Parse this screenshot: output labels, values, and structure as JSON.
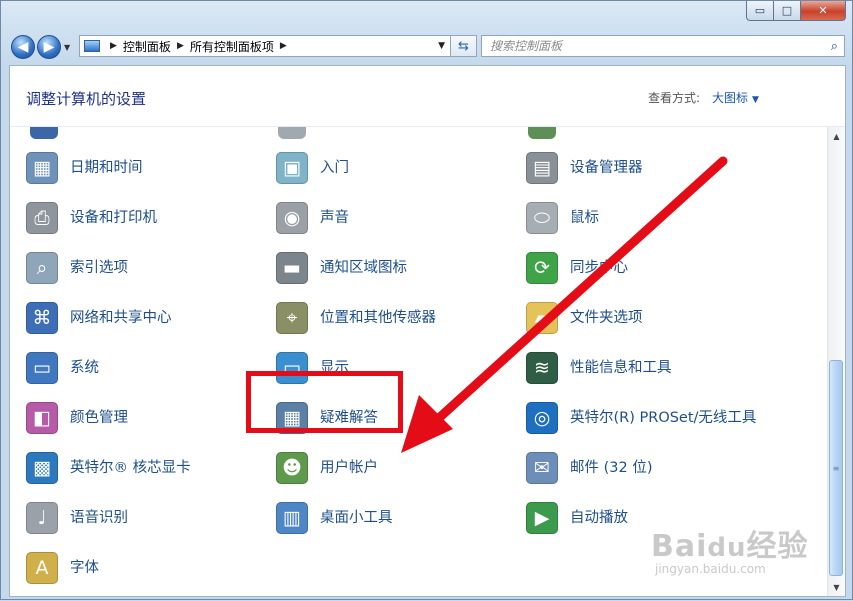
{
  "window": {
    "minimize_glyph": "▭",
    "maximize_glyph": "□",
    "close_glyph": "✕"
  },
  "navigation": {
    "back_glyph": "◀",
    "forward_glyph": "▶",
    "breadcrumb": [
      "控制面板",
      "所有控制面板项"
    ],
    "search_placeholder": "搜索控制面板"
  },
  "header": {
    "title": "调整计算机的设置",
    "view_by_label": "查看方式:",
    "view_by_value": "大图标"
  },
  "items": [
    {
      "label": "日期和时间",
      "icon": "calendar-clock-icon",
      "color": "#6f93b8",
      "glyph": "▦"
    },
    {
      "label": "入门",
      "icon": "getting-started-icon",
      "color": "#7fb3c8",
      "glyph": "▣"
    },
    {
      "label": "设备管理器",
      "icon": "device-manager-icon",
      "color": "#8a9097",
      "glyph": "▤"
    },
    {
      "label": "设备和打印机",
      "icon": "printer-icon",
      "color": "#8e959c",
      "glyph": "⎙"
    },
    {
      "label": "声音",
      "icon": "speaker-icon",
      "color": "#9aa0a6",
      "glyph": "◉"
    },
    {
      "label": "鼠标",
      "icon": "mouse-icon",
      "color": "#a6adb3",
      "glyph": "⬭"
    },
    {
      "label": "索引选项",
      "icon": "index-magnifier-icon",
      "color": "#8fa5b8",
      "glyph": "⌕"
    },
    {
      "label": "通知区域图标",
      "icon": "notification-area-icon",
      "color": "#7d858c",
      "glyph": "▬"
    },
    {
      "label": "同步中心",
      "icon": "sync-center-icon",
      "color": "#3fa447",
      "glyph": "⟳"
    },
    {
      "label": "网络和共享中心",
      "icon": "network-center-icon",
      "color": "#3e6fb6",
      "glyph": "⌘"
    },
    {
      "label": "位置和其他传感器",
      "icon": "location-sensor-icon",
      "color": "#8b8f66",
      "glyph": "⌖"
    },
    {
      "label": "文件夹选项",
      "icon": "folder-options-icon",
      "color": "#e6c25a",
      "glyph": "▰"
    },
    {
      "label": "系统",
      "icon": "system-computer-icon",
      "color": "#3f78c0",
      "glyph": "▭"
    },
    {
      "label": "显示",
      "icon": "display-monitor-icon",
      "color": "#3a8fd1",
      "glyph": "▭"
    },
    {
      "label": "性能信息和工具",
      "icon": "performance-icon",
      "color": "#2f5d45",
      "glyph": "≋"
    },
    {
      "label": "颜色管理",
      "icon": "color-management-icon",
      "color": "#b75aa8",
      "glyph": "◧"
    },
    {
      "label": "疑难解答",
      "icon": "troubleshooting-icon",
      "color": "#5c7fa6",
      "glyph": "▦"
    },
    {
      "label": "英特尔(R) PROSet/无线工具",
      "icon": "wireless-icon",
      "color": "#1f6fc1",
      "glyph": "◎"
    },
    {
      "label": "英特尔® 核芯显卡",
      "icon": "intel-graphics-icon",
      "color": "#2c79bd",
      "glyph": "▩"
    },
    {
      "label": "用户帐户",
      "icon": "user-accounts-icon",
      "color": "#5e9a4e",
      "glyph": "☻"
    },
    {
      "label": "邮件 (32 位)",
      "icon": "mail-icon",
      "color": "#6d8eb8",
      "glyph": "✉"
    },
    {
      "label": "语音识别",
      "icon": "microphone-icon",
      "color": "#9aa1a8",
      "glyph": "♩"
    },
    {
      "label": "桌面小工具",
      "icon": "gadgets-icon",
      "color": "#4f86c6",
      "glyph": "▥"
    },
    {
      "label": "自动播放",
      "icon": "autoplay-icon",
      "color": "#3c9a4c",
      "glyph": "▶"
    },
    {
      "label": "字体",
      "icon": "font-icon",
      "color": "#d0b04a",
      "glyph": "A"
    }
  ],
  "scrollbar": {
    "up_glyph": "▲",
    "down_glyph": "▼",
    "grip_glyph": "≡"
  },
  "watermark": {
    "text": "Bai",
    "paw": "du",
    "suffix": "经验",
    "url": "jingyan.baidu.com"
  }
}
